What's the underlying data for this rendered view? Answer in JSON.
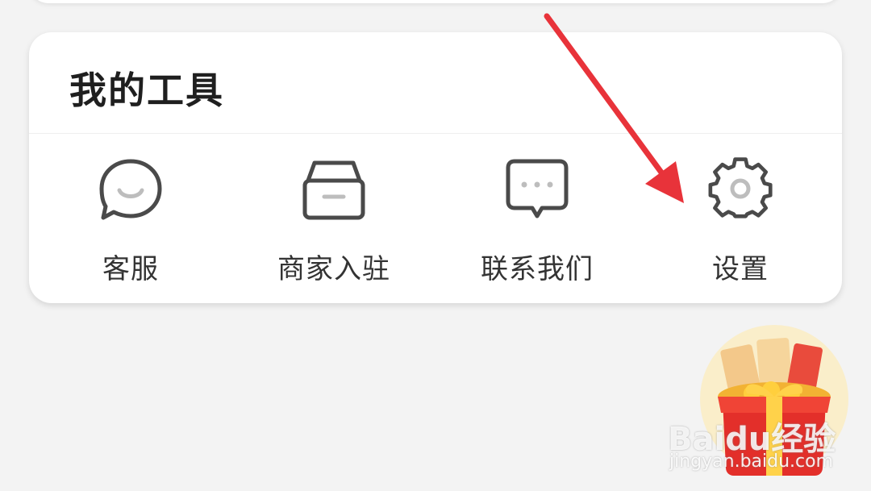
{
  "tools_card": {
    "title": "我的工具",
    "items": [
      {
        "label": "客服",
        "icon": "customer-service-icon"
      },
      {
        "label": "商家入驻",
        "icon": "merchant-box-icon"
      },
      {
        "label": "联系我们",
        "icon": "chat-bubble-icon"
      },
      {
        "label": "设置",
        "icon": "gear-icon"
      }
    ]
  },
  "annotation": {
    "arrow_color": "#e8333a",
    "target": "设置"
  },
  "watermark": {
    "brand": "Baidu经验",
    "url": "jingyan.baidu.com"
  },
  "colors": {
    "background": "#f3f3f3",
    "card": "#ffffff",
    "title_text": "#1f1f1f",
    "label_text": "#333333",
    "icon_stroke": "#4a4a4a"
  }
}
